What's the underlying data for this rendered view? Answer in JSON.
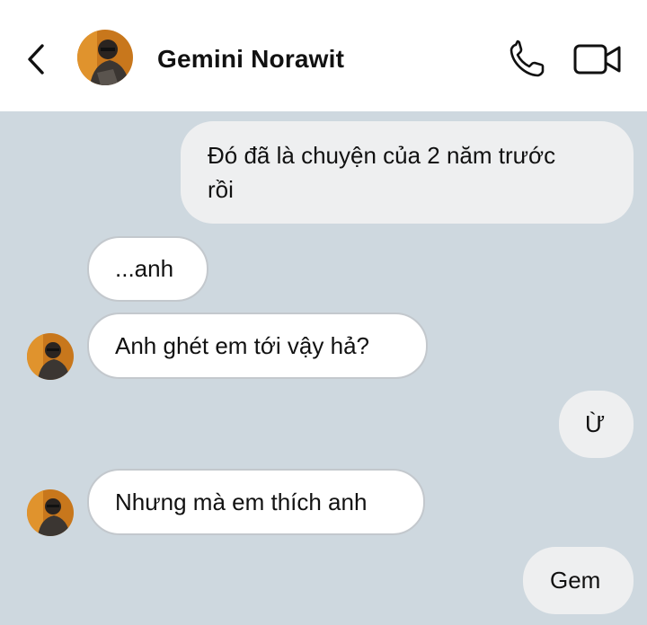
{
  "header": {
    "contact_name": "Gemini Norawit",
    "back_icon": "chevron-left-icon",
    "call_icon": "phone-icon",
    "video_icon": "video-camera-icon"
  },
  "messages": [
    {
      "direction": "outgoing",
      "text_line1": "Đó đã là chuyện của 2 năm trước",
      "text_line2": "rồi"
    },
    {
      "direction": "incoming",
      "text": "...anh"
    },
    {
      "direction": "incoming",
      "text": "Anh ghét em tới vậy hả?"
    },
    {
      "direction": "outgoing",
      "text": "Ừ"
    },
    {
      "direction": "incoming",
      "text": "Nhưng mà em thích anh"
    },
    {
      "direction": "outgoing",
      "text": "Gem"
    }
  ],
  "colors": {
    "chat_background": "#ced8df",
    "outgoing_bubble": "#eeeff0",
    "incoming_bubble": "#ffffff",
    "incoming_border": "#c3c8cd"
  }
}
